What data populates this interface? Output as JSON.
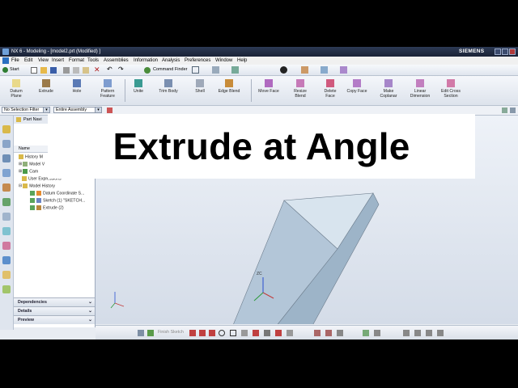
{
  "window": {
    "title": "NX 6 - Modeling - [model2.prt (Modified) ]",
    "brand": "SIEMENS"
  },
  "menu": [
    "File",
    "Edit",
    "View",
    "Insert",
    "Format",
    "Tools",
    "Assemblies",
    "Information",
    "Analysis",
    "Preferences",
    "Window",
    "Help"
  ],
  "toolbar1": {
    "start": "Start",
    "command_finder": "Command Finder"
  },
  "toolbar2": [
    {
      "label": "Datum\nPlane"
    },
    {
      "label": "Extrude"
    },
    {
      "label": "Hole"
    },
    {
      "label": "Pattern\nFeature"
    },
    {
      "label": "Unite"
    },
    {
      "label": "Trim Body"
    },
    {
      "label": "Shell"
    },
    {
      "label": "Edge Blend"
    },
    {
      "label": "Move Face"
    },
    {
      "label": "Resize\nBlend"
    },
    {
      "label": "Delete\nFace"
    },
    {
      "label": "Copy Face"
    },
    {
      "label": "Make\nCoplanar"
    },
    {
      "label": "Linear\nDimension"
    },
    {
      "label": "Edit Cross\nSection"
    }
  ],
  "filters": {
    "selection_filter": "No Selection Filter",
    "scope": "Entire Assembly"
  },
  "navigator": {
    "title": "Part Navi",
    "col_name": "Name",
    "items": [
      {
        "label": "History M"
      },
      {
        "label": "Model V"
      },
      {
        "label": "Cam"
      },
      {
        "label": "User Expressions"
      },
      {
        "label": "Model History"
      },
      {
        "label": "Datum Coordinate S..."
      },
      {
        "label": "Sketch (1) \"SKETCH..."
      },
      {
        "label": "Extrude (2)"
      }
    ]
  },
  "panels": {
    "dependencies": "Dependencies",
    "details": "Details",
    "preview": "Preview"
  },
  "axis_label": "ZC",
  "sketch_bar": {
    "finish": "Finish Sketch"
  },
  "banner": {
    "text": "Extrude at Angle"
  },
  "colors": {
    "solid_face_light": "#d8e4ee",
    "solid_face_mid": "#b3c6d8",
    "solid_face_dark": "#9db4c8",
    "banner_bg": "#ffffff"
  }
}
